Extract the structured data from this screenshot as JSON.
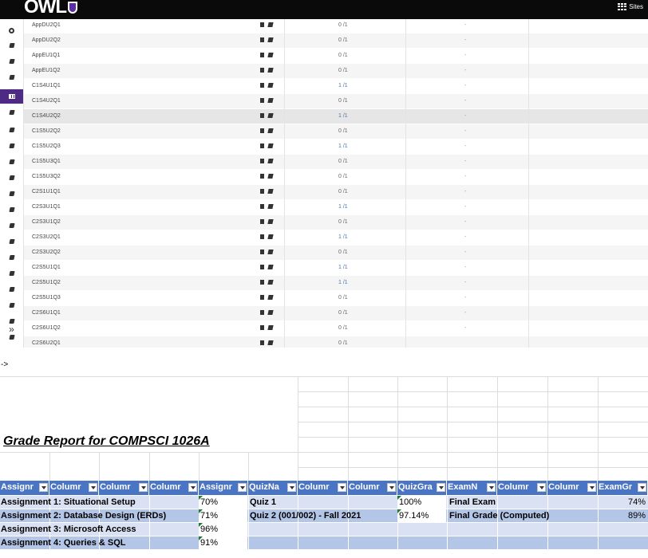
{
  "header": {
    "logo_text": "OWL",
    "sites_label": "Sites"
  },
  "icons": {
    "rail": [
      "globe-icon",
      "book-icon",
      "book-icon",
      "book-icon",
      "grid-icon",
      "book-icon",
      "book-icon",
      "book-icon",
      "book-icon",
      "book-icon",
      "book-icon",
      "book-icon",
      "book-icon",
      "book-icon",
      "book-icon",
      "book-icon",
      "book-icon",
      "book-icon",
      "book-icon",
      "book-icon",
      "expand-icon"
    ],
    "expand_glyph": "»"
  },
  "gradebook": {
    "rows": [
      {
        "name": "AppDU2Q1",
        "score": "0 /1",
        "dash": "-"
      },
      {
        "name": "AppDU2Q2",
        "score": "0 /1",
        "dash": "-"
      },
      {
        "name": "AppEU1Q1",
        "score": "0 /1",
        "dash": "-"
      },
      {
        "name": "AppEU1Q2",
        "score": "0 /1",
        "dash": "-"
      },
      {
        "name": "C1S4U1Q1",
        "score": "1 /1",
        "dash": "-"
      },
      {
        "name": "C1S4U2Q1",
        "score": "0 /1",
        "dash": "-"
      },
      {
        "name": "C1S4U2Q2",
        "score": "1 /1",
        "dash": "-"
      },
      {
        "name": "C1S5U2Q2",
        "score": "0 /1",
        "dash": "-"
      },
      {
        "name": "C1S5U2Q3",
        "score": "1 /1",
        "dash": "-"
      },
      {
        "name": "C1S5U3Q1",
        "score": "0 /1",
        "dash": "-"
      },
      {
        "name": "C1S5U3Q2",
        "score": "0 /1",
        "dash": "-"
      },
      {
        "name": "C2S1U1Q1",
        "score": "0 /1",
        "dash": "-"
      },
      {
        "name": "C2S3U1Q1",
        "score": "1 /1",
        "dash": "-"
      },
      {
        "name": "C2S3U1Q2",
        "score": "0 /1",
        "dash": "-"
      },
      {
        "name": "C2S3U2Q1",
        "score": "1 /1",
        "dash": "-"
      },
      {
        "name": "C2S3U2Q2",
        "score": "0 /1",
        "dash": "-"
      },
      {
        "name": "C2S5U1Q1",
        "score": "1 /1",
        "dash": "-"
      },
      {
        "name": "C2S5U1Q2",
        "score": "1 /1",
        "dash": "-"
      },
      {
        "name": "C2S5U1Q3",
        "score": "0 /1",
        "dash": "-"
      },
      {
        "name": "C2S6U1Q1",
        "score": "0 /1",
        "dash": "-"
      },
      {
        "name": "C2S6U1Q2",
        "score": "0 /1",
        "dash": "-"
      },
      {
        "name": "C2S6U2Q1",
        "score": "0 /1",
        "dash": ""
      }
    ]
  },
  "arrow_text": "->",
  "report": {
    "title": "Grade Report for COMPSCI 1026A",
    "headers": [
      "Assignr",
      "Columr",
      "Columr",
      "Columr",
      "Assignr",
      "QuizNa",
      "Columr",
      "Columr",
      "QuizGra",
      "ExamN",
      "Columr",
      "Columr",
      "ExamGr"
    ],
    "rows": [
      {
        "assignment": "Assignment 1: Situational Setup",
        "a_grade": "70%",
        "quiz": "Quiz 1",
        "quiz_grade": "100%",
        "exam": "Final Exam",
        "exam_grade": "74%"
      },
      {
        "assignment": "Assignment 2: Database Design (ERDs)",
        "a_grade": "71%",
        "quiz": "Quiz 2 (001/002) - Fall 2021",
        "quiz_grade": "97.14%",
        "exam": "Final Grade (Computed)",
        "exam_grade": "89%"
      },
      {
        "assignment": "Assignment 3: Microsoft Access",
        "a_grade": "96%",
        "quiz": "",
        "quiz_grade": "",
        "exam": "",
        "exam_grade": ""
      },
      {
        "assignment": "Assignment 4: Queries & SQL",
        "a_grade": "91%",
        "quiz": "",
        "quiz_grade": "",
        "exam": "",
        "exam_grade": ""
      }
    ]
  },
  "colors": {
    "topbar": "#0a0a0a",
    "rail_active": "#4e2a84",
    "excel_header": "#4a74c4",
    "excel_band_light": "#d9e1f2",
    "excel_band_dark": "#b4c6e7",
    "score_full": "#4b76a6"
  }
}
